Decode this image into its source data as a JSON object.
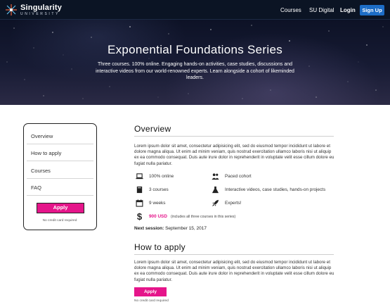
{
  "nav": {
    "logo_title": "Singularity",
    "logo_subtitle": "UNIVERSITY",
    "links": [
      "Courses",
      "SU Digital"
    ],
    "login": "Login",
    "signup": "Sign Up",
    "colors": {
      "bar": "#0b1424",
      "signup": "#1d6dc6"
    }
  },
  "hero": {
    "title": "Exponential Foundations Series",
    "text": "Three courses. 100% online. Engaging hands-on activities, case studies, discussions and interactive videos from our world-renowned experts. Learn alongside a cohort of likeminded leaders."
  },
  "sidebar": {
    "items": [
      "Overview",
      "How to apply",
      "Courses",
      "FAQ"
    ],
    "apply": "Apply",
    "note": "No credit card required"
  },
  "overview": {
    "heading": "Overview",
    "body": "Lorem ipsum dolor sit amet, consectetur adipisicing elit, sed do eiusmod tempor incididunt ut labore et dolore magna aliqua. Ut enim ad minim veniam, quis nostrud exercitation ullamco laboris nisi ut aliquip ex ea commodo consequat. Duis aute irure dolor in reprehenderit in voluptate velit esse cillum dolore eu fugiat nulla pariatur.",
    "features": [
      {
        "icon": "laptop-icon",
        "text": "100% online"
      },
      {
        "icon": "people-icon",
        "text": "Paced cohort"
      },
      {
        "icon": "book-icon",
        "text": "3 courses"
      },
      {
        "icon": "flask-icon",
        "text": "Interactive videos, case studies, hands-on projects"
      },
      {
        "icon": "calendar-icon",
        "text": "9 weeks"
      },
      {
        "icon": "rocket-icon",
        "text": "Experts!"
      }
    ],
    "price": "900 USD",
    "price_note": "(includes all three courses in this series)",
    "next_session_label": "Next session:",
    "next_session_date": "September 15, 2017"
  },
  "how_to_apply": {
    "heading": "How to apply",
    "body": "Lorem ipsum dolor sit amet, consectetur adipisicing elit, sed do eiusmod tempor incididunt ut labore et dolore magna aliqua. Ut enim ad minim veniam, quis nostrud exercitation ullamco laboris nisi ut aliquip ex ea commodo consequat. Duis aute irure dolor in reprehenderit in voluptate velit esse cillum dolore eu fugiat nulla pariatur.",
    "apply": "Apply",
    "note": "No credit card required"
  },
  "accent_color": "#e5158a"
}
